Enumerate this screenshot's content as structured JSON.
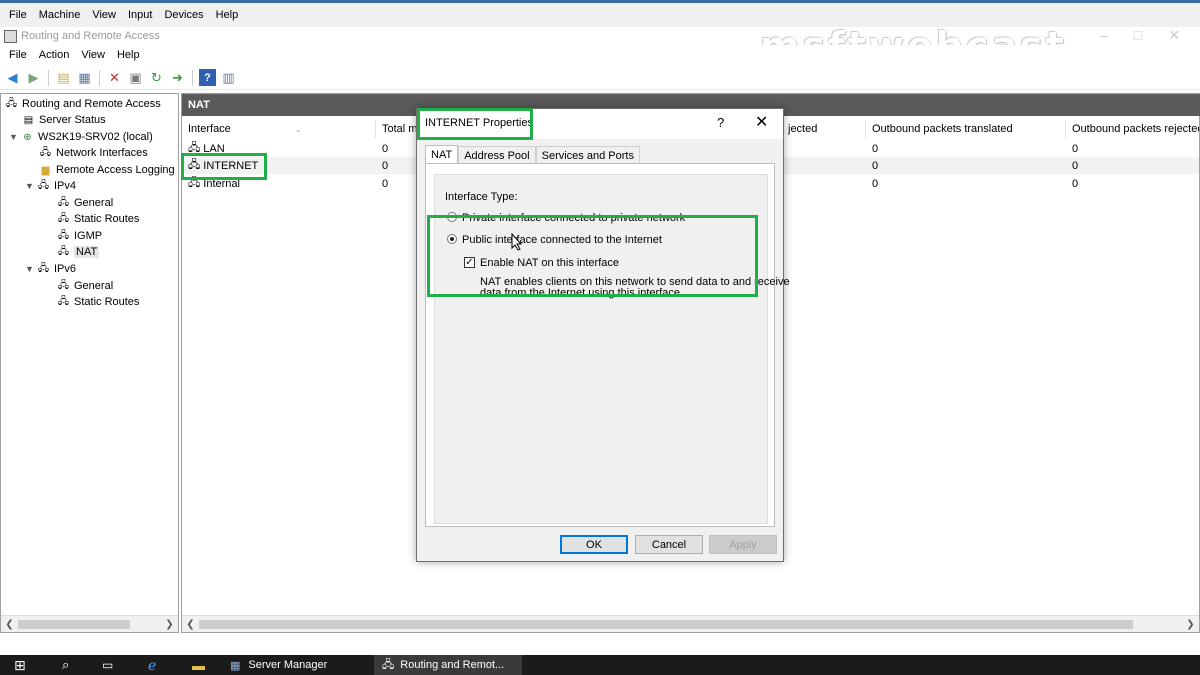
{
  "vm_menu": [
    "File",
    "Machine",
    "View",
    "Input",
    "Devices",
    "Help"
  ],
  "window": {
    "title": "Routing and Remote Access",
    "watermark": "msftwebcast"
  },
  "mmc_menu": [
    "File",
    "Action",
    "View",
    "Help"
  ],
  "toolbar": {
    "icons": [
      "back-icon",
      "forward-icon",
      "up-folder-icon",
      "show-hide-tree-icon",
      "delete-icon",
      "properties-icon",
      "refresh-icon",
      "export-icon",
      "help-icon",
      "console-icon"
    ]
  },
  "tree": {
    "items": [
      {
        "label": "Routing and Remote Access"
      },
      {
        "label": "Server Status"
      },
      {
        "label": "WS2K19-SRV02 (local)"
      },
      {
        "label": "Network Interfaces"
      },
      {
        "label": "Remote Access Logging"
      },
      {
        "label": "IPv4"
      },
      {
        "label": "General"
      },
      {
        "label": "Static Routes"
      },
      {
        "label": "IGMP"
      },
      {
        "label": "NAT"
      },
      {
        "label": "IPv6"
      },
      {
        "label": "General"
      },
      {
        "label": "Static Routes"
      }
    ]
  },
  "nat_panel": {
    "header": "NAT",
    "columns": [
      "Interface",
      "Total m",
      "jected",
      "Outbound packets translated",
      "Outbound packets rejected"
    ],
    "rows": [
      {
        "name": "LAN",
        "total": "0",
        "translated": "0",
        "rejected": "0"
      },
      {
        "name": "INTERNET",
        "total": "0",
        "translated": "0",
        "rejected": "0"
      },
      {
        "name": "Internal",
        "total": "0",
        "translated": "0",
        "rejected": "0"
      }
    ]
  },
  "dialog": {
    "title": "INTERNET Properties",
    "help": "?",
    "close": "✕",
    "tabs": [
      "NAT",
      "Address Pool",
      "Services and Ports"
    ],
    "interface_type_label": "Interface Type:",
    "private_option": "Private interface connected to private network",
    "public_option": "Public interface connected to the Internet",
    "enable_nat": "Enable NAT on this interface",
    "nat_desc_line1": "NAT enables clients on this network to send data to and receive",
    "nat_desc_line2": "data from the Internet using this interface.",
    "ok": "OK",
    "cancel": "Cancel",
    "apply": "Apply"
  },
  "taskbar": {
    "server_manager": "Server Manager",
    "rras": "Routing and Remot..."
  }
}
